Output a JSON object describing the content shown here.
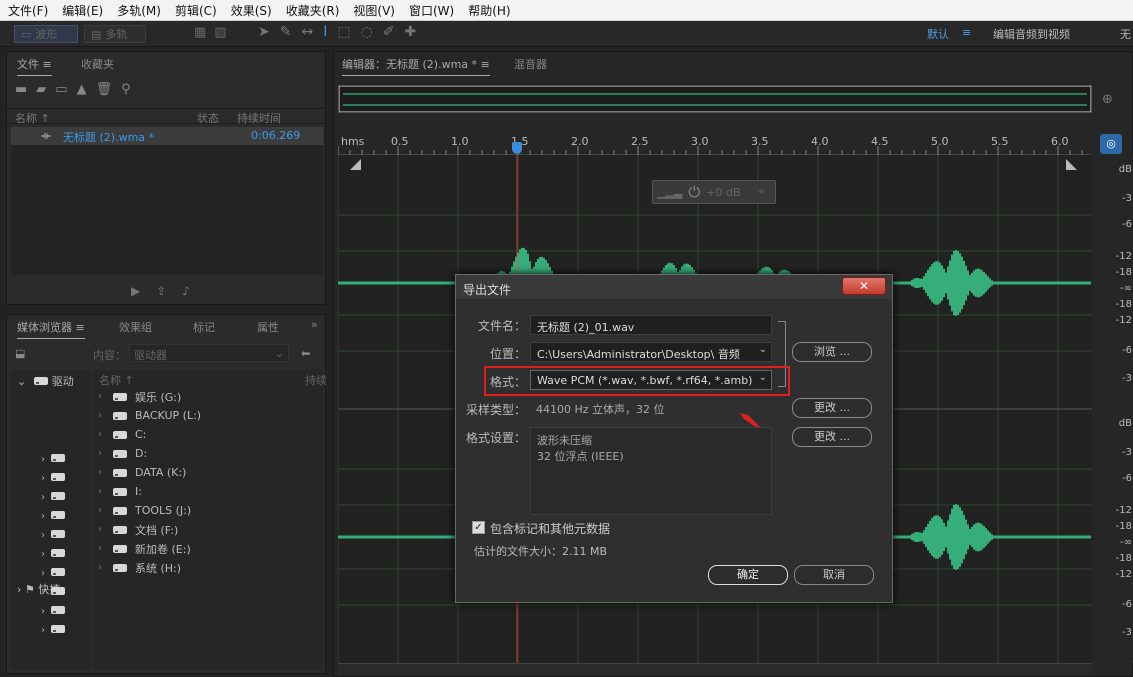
{
  "menu": [
    "文件(F)",
    "编辑(E)",
    "多轨(M)",
    "剪辑(C)",
    "效果(S)",
    "收藏夹(R)",
    "视图(V)",
    "窗口(W)",
    "帮助(H)"
  ],
  "toolbar": {
    "waveform": "波形",
    "multitrack": "多轨",
    "workspace_default": "默认",
    "workspace_edit": "编辑音频到视频",
    "workspace_more": "无"
  },
  "files_panel": {
    "tab_files": "文件",
    "tab_favorites": "收藏夹",
    "col_name": "名称",
    "col_status": "状态",
    "col_duration": "持续时间",
    "file_name": "无标题 (2).wma *",
    "file_duration": "0:06.269"
  },
  "media_panel": {
    "tab_browser": "媒体浏览器",
    "tab_effects": "效果组",
    "tab_markers": "标记",
    "tab_properties": "属性",
    "content_label": "内容：",
    "content_value": "驱动器",
    "col_name": "名称",
    "col_duration": "持续",
    "root": "驱动",
    "quick": "快捷",
    "drives": [
      "娱乐 (G:)",
      "BACKUP (L:)",
      "C:",
      "D:",
      "DATA (K:)",
      "I:",
      "TOOLS (J:)",
      "文档 (F:)",
      "新加卷 (E:)",
      "系统 (H:)"
    ]
  },
  "editor": {
    "tab_editor": "编辑器：无标题 (2).wma *",
    "tab_mixer": "混音器",
    "ruler_unit": "hms",
    "ruler_ticks": [
      "0.5",
      "1.0",
      "1.5",
      "2.0",
      "2.5",
      "3.0",
      "3.5",
      "4.0",
      "4.5",
      "5.0",
      "5.5",
      "6.0"
    ],
    "gain": "+0 dB",
    "db_top": [
      "dB",
      "-3",
      "-6",
      "-12",
      "-18",
      "-∞",
      "-18",
      "-12",
      "-6",
      "-3"
    ],
    "db_bottom": [
      "dB",
      "-3",
      "-6",
      "-12",
      "-18",
      "-∞",
      "-18",
      "-12",
      "-6",
      "-3"
    ]
  },
  "dialog": {
    "title": "导出文件",
    "filename_label": "文件名：",
    "filename": "无标题 (2)_01.wav",
    "location_label": "位置：",
    "location": "C:\\Users\\Administrator\\Desktop\\ 音频",
    "browse": "浏览 ...",
    "format_label": "格式：",
    "format": "Wave PCM (*.wav, *.bwf, *.rf64, *.amb)",
    "sample_label": "采样类型：",
    "sample": "44100 Hz 立体声，32 位",
    "change": "更改 ...",
    "fmtset_label": "格式设置：",
    "fmtset_line1": "波形未压缩",
    "fmtset_line2": "32 位浮点 (IEEE)",
    "include_meta": "包含标记和其他元数据",
    "est_size": "估计的文件大小：2.11 MB",
    "ok": "确定",
    "cancel": "取消"
  },
  "colors": {
    "wave": "#3ddc97",
    "accent": "#2d8ceb",
    "highlight": "#e02020"
  }
}
